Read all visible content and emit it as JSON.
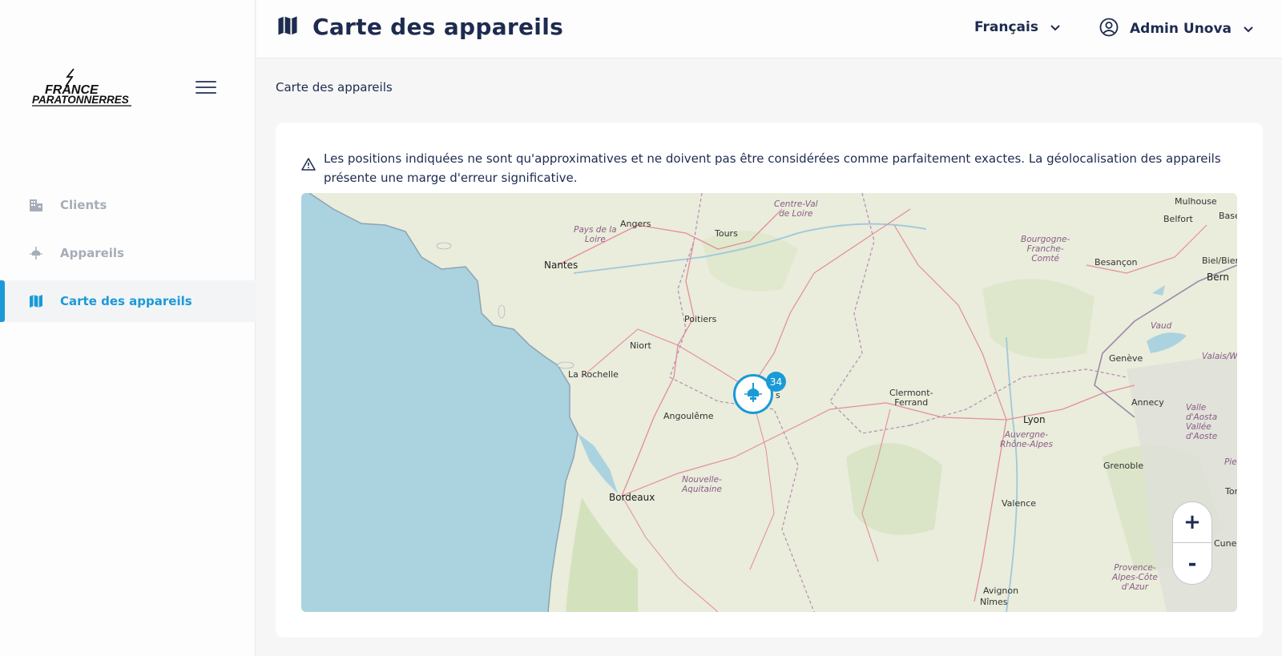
{
  "sidebar": {
    "logo": {
      "line1": "FRANCE",
      "line2": "PARATONNERRES"
    },
    "items": [
      {
        "label": "Clients",
        "icon": "building-icon",
        "active": false
      },
      {
        "label": "Appareils",
        "icon": "lightning-rod-icon",
        "active": false
      },
      {
        "label": "Carte des appareils",
        "icon": "map-icon",
        "active": true
      }
    ]
  },
  "header": {
    "title": "Carte des appareils",
    "language": "Français",
    "user": "Admin Unova"
  },
  "breadcrumb": "Carte des appareils",
  "notice": "Les positions indiquées ne sont qu'approximatives et ne doivent pas être considérées comme parfaitement exactes. La géolocalisation des appareils présente une marge d'erreur significative.",
  "map": {
    "cities": {
      "mulhouse": "Mulhouse",
      "belfort": "Belfort",
      "basel": "Basel",
      "angers": "Angers",
      "tours": "Tours",
      "nantes": "Nantes",
      "besancon": "Besançon",
      "biel": "Biel/Bienne",
      "bern": "Bern",
      "poitiers": "Poitiers",
      "niort": "Niort",
      "larochelle": "La Rochelle",
      "geneve": "Genève",
      "clermont": "Clermont-\nFerrand",
      "annecy": "Annecy",
      "angouleme": "Angoulême",
      "lyon": "Lyon",
      "grenoble": "Grenoble",
      "bordeaux": "Bordeaux",
      "valence": "Valence",
      "torino": "Tori",
      "cuneo": "Cuneo",
      "avignon": "Avignon",
      "nimes": "Nîmes",
      "limoges_tail": "s"
    },
    "regions": {
      "cvl": "Centre-Val\nde Loire",
      "pdl": "Pays de la\nLoire",
      "bfc": "Bourgogne-\nFranche-\nComté",
      "vaud": "Vaud",
      "valais": "Valais/W",
      "aura": "Auvergne-\nRhône-Alpes",
      "aosta": "Valle d'Aosta\nVallée d'Aoste",
      "na": "Nouvelle-\nAquitaine",
      "paca": "Provence-\nAlpes-Côte\nd'Azur",
      "pie": "Pie"
    },
    "cluster_count": "34",
    "zoom_in": "+",
    "zoom_out": "-"
  },
  "colors": {
    "accent": "#1a9ad6",
    "sea": "#aad3df",
    "land": "#eaecdc",
    "text": "#1d2b4f"
  }
}
